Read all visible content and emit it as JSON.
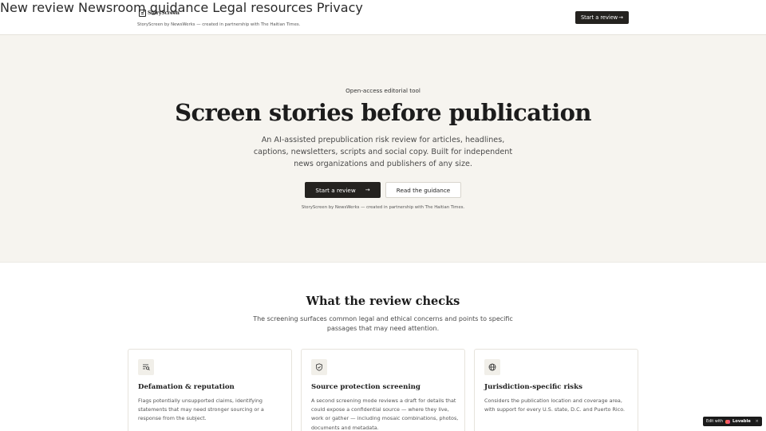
{
  "header": {
    "logo_text": "StoryScreen",
    "tagline": "StoryScreen by NewsWerks — created in partnership with The Haitian Times.",
    "nav": [
      {
        "label": "New review"
      },
      {
        "label": "Newsroom guidance"
      },
      {
        "label": "Legal resources"
      },
      {
        "label": "Privacy"
      }
    ],
    "cta_label": "Start a review"
  },
  "hero": {
    "eyebrow": "Open-access editorial tool",
    "title": "Screen stories before publication",
    "subtitle": "An AI-assisted prepublication risk review for articles, headlines, captions, newsletters, scripts and social copy. Built for independent news organizations and publishers of any size.",
    "primary_button": "Start a review",
    "secondary_button": "Read the guidance",
    "credit": "StoryScreen by NewsWerks — created in partnership with The Haitian Times."
  },
  "checks": {
    "title": "What the review checks",
    "subtitle": "The screening surfaces common legal and ethical concerns and points to specific passages that may need attention.",
    "cards": [
      {
        "icon": "text-search-icon",
        "title": "Defamation & reputation",
        "body": "Flags potentially unsupported claims, identifying statements that may need stronger sourcing or a response from the subject."
      },
      {
        "icon": "shield-check-icon",
        "title": "Source protection screening",
        "body": "A second screening mode reviews a draft for details that could expose a confidential source — where they live, work or gather — including mosaic combinations, photos, documents and metadata."
      },
      {
        "icon": "globe-icon",
        "title": "Jurisdiction-specific risks",
        "body": "Considers the publication location and coverage area, with support for every U.S. state, D.C. and Puerto Rico."
      }
    ]
  },
  "badge": {
    "prefix": "Edit with",
    "brand": "Lovable",
    "close": "×"
  }
}
